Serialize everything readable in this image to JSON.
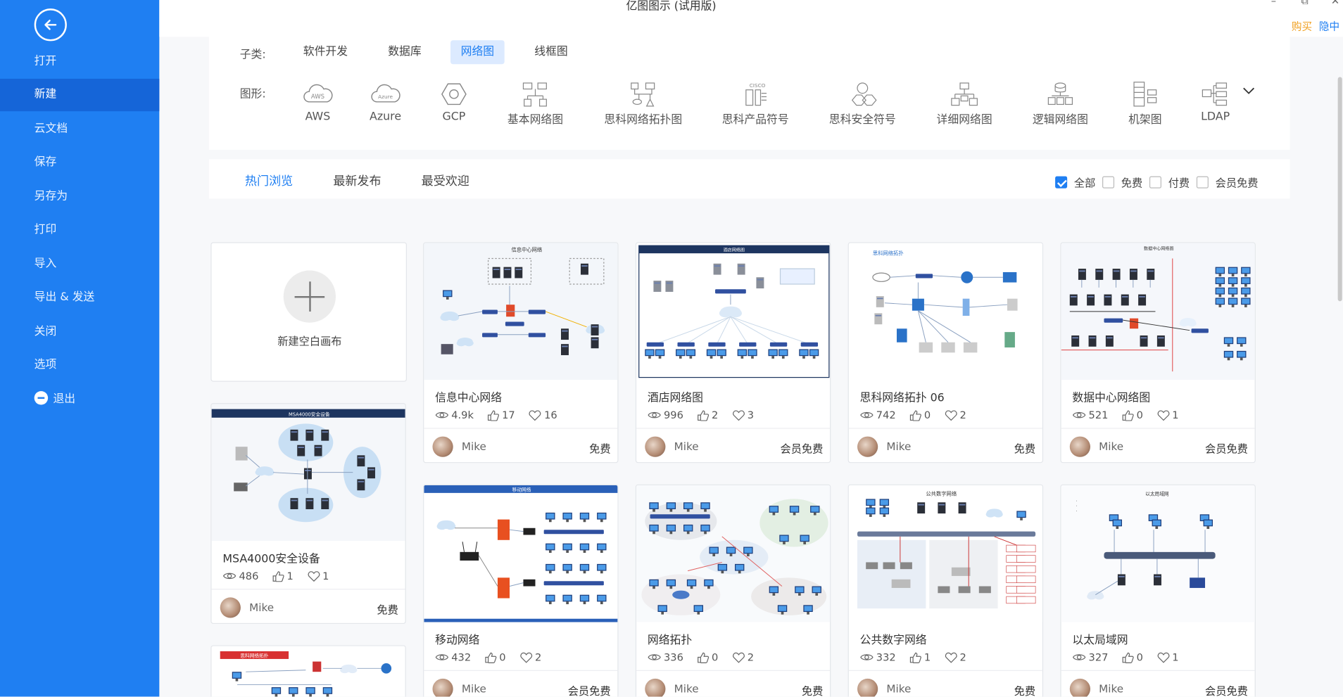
{
  "window": {
    "title": "亿图图示 (试用版)",
    "buy_label": "购买",
    "hide_label": "隐中"
  },
  "sidebar": {
    "items": [
      {
        "label": "打开"
      },
      {
        "label": "新建"
      },
      {
        "label": "云文档"
      },
      {
        "label": "保存"
      },
      {
        "label": "另存为"
      },
      {
        "label": "打印"
      },
      {
        "label": "导入"
      },
      {
        "label": "导出 & 发送"
      },
      {
        "label": "关闭"
      },
      {
        "label": "选项"
      },
      {
        "label": "退出"
      }
    ],
    "active": "新建"
  },
  "filters": {
    "subcat_label": "子类:",
    "subcats": [
      "软件开发",
      "数据库",
      "网络图",
      "线框图"
    ],
    "active_subcat": "网络图",
    "shape_label": "图形:",
    "shapes": [
      "AWS",
      "Azure",
      "GCP",
      "基本网络图",
      "思科网络拓扑图",
      "思科产品符号",
      "思科安全符号",
      "详细网络图",
      "逻辑网络图",
      "机架图",
      "LDAP"
    ],
    "shape_icon_text": {
      "aws": "AWS",
      "azure": "Azure",
      "cisco": "CISCO"
    }
  },
  "tabs": {
    "items": [
      "热门浏览",
      "最新发布",
      "最受欢迎"
    ],
    "active": "热门浏览"
  },
  "price_filters": [
    {
      "label": "全部",
      "checked": true
    },
    {
      "label": "免费",
      "checked": false
    },
    {
      "label": "付费",
      "checked": false
    },
    {
      "label": "会员免费",
      "checked": false
    }
  ],
  "new_canvas": {
    "label": "新建空白画布"
  },
  "cards": [
    {
      "title": "信息中心网络",
      "views": "4.9k",
      "likes": "17",
      "favs": "16",
      "author": "Mike",
      "price": "免费"
    },
    {
      "title": "酒店网络图",
      "views": "996",
      "likes": "2",
      "favs": "3",
      "author": "Mike",
      "price": "会员免费"
    },
    {
      "title": "思科网络拓扑 06",
      "views": "742",
      "likes": "0",
      "favs": "2",
      "author": "Mike",
      "price": "免费"
    },
    {
      "title": "数据中心网络图",
      "views": "521",
      "likes": "0",
      "favs": "1",
      "author": "Mike",
      "price": "会员免费"
    },
    {
      "title": "MSA4000安全设备",
      "views": "486",
      "likes": "1",
      "favs": "1",
      "author": "Mike",
      "price": "免费"
    },
    {
      "title": "移动网络",
      "views": "432",
      "likes": "0",
      "favs": "2",
      "author": "Mike",
      "price": "会员免费"
    },
    {
      "title": "网络拓扑",
      "views": "336",
      "likes": "0",
      "favs": "2",
      "author": "Mike",
      "price": "免费"
    },
    {
      "title": "公共数字网络",
      "views": "332",
      "likes": "1",
      "favs": "2",
      "author": "Mike",
      "price": "免费"
    },
    {
      "title": "以太局域网",
      "views": "327",
      "likes": "0",
      "favs": "1",
      "author": "Mike",
      "price": "会员免费"
    }
  ],
  "thumb_texts": {
    "msa_banner": "MSA4000安全设备",
    "mobile_banner": "移动网络",
    "hotel_banner": "酒店网络图",
    "info_center": "信息中心网络",
    "cisco06": "思科网络拓扑",
    "datacenter": "数据中心网络图",
    "public_net": "公共数字网络",
    "ethernet": "以太局域网",
    "partial_banner": "思科网络拓扑"
  }
}
